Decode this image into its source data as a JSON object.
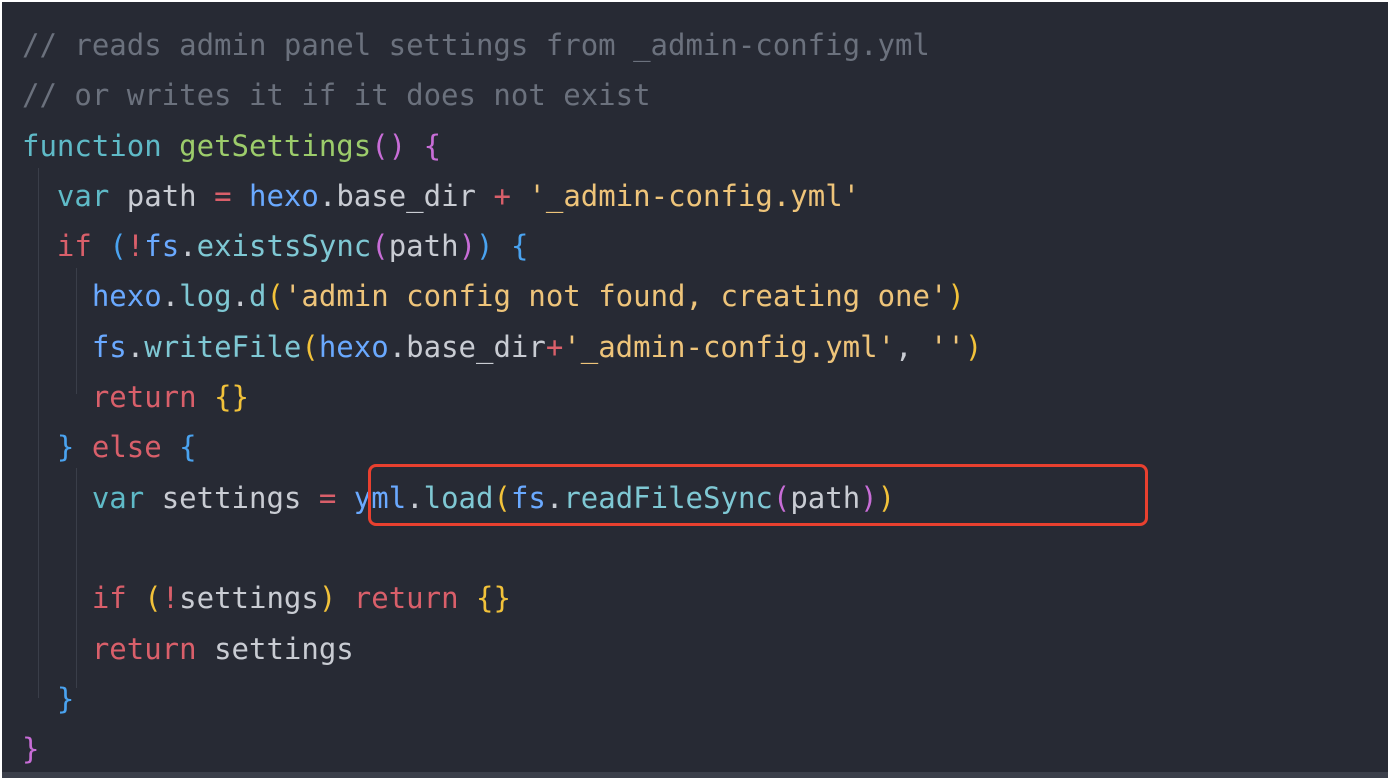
{
  "editor": {
    "lines": [
      [
        {
          "t": "// reads admin panel settings from _admin-config.yml",
          "c": "comment"
        }
      ],
      [
        {
          "t": "// or writes it if it does not exist",
          "c": "comment"
        }
      ],
      [
        {
          "t": "function",
          "c": "storage"
        },
        {
          "t": " ",
          "c": "plain"
        },
        {
          "t": "getSettings",
          "c": "func"
        },
        {
          "t": "()",
          "c": "brace-p"
        },
        {
          "t": " ",
          "c": "plain"
        },
        {
          "t": "{",
          "c": "brace-p"
        }
      ],
      [
        {
          "t": "  ",
          "c": "plain"
        },
        {
          "t": "var",
          "c": "storage"
        },
        {
          "t": " path ",
          "c": "plain"
        },
        {
          "t": "=",
          "c": "op"
        },
        {
          "t": " ",
          "c": "plain"
        },
        {
          "t": "hexo",
          "c": "obj"
        },
        {
          "t": ".base_dir ",
          "c": "plain"
        },
        {
          "t": "+",
          "c": "op"
        },
        {
          "t": " ",
          "c": "plain"
        },
        {
          "t": "'_admin-config.yml'",
          "c": "string"
        }
      ],
      [
        {
          "t": "  ",
          "c": "plain"
        },
        {
          "t": "if",
          "c": "keyword"
        },
        {
          "t": " ",
          "c": "plain"
        },
        {
          "t": "(",
          "c": "brace-b"
        },
        {
          "t": "!",
          "c": "op"
        },
        {
          "t": "fs",
          "c": "obj"
        },
        {
          "t": ".",
          "c": "plain"
        },
        {
          "t": "existsSync",
          "c": "method"
        },
        {
          "t": "(",
          "c": "brace-p"
        },
        {
          "t": "path",
          "c": "plain"
        },
        {
          "t": ")",
          "c": "brace-p"
        },
        {
          "t": ")",
          "c": "brace-b"
        },
        {
          "t": " ",
          "c": "plain"
        },
        {
          "t": "{",
          "c": "brace-b"
        }
      ],
      [
        {
          "t": "    ",
          "c": "plain"
        },
        {
          "t": "hexo",
          "c": "obj"
        },
        {
          "t": ".",
          "c": "plain"
        },
        {
          "t": "log",
          "c": "method"
        },
        {
          "t": ".",
          "c": "plain"
        },
        {
          "t": "d",
          "c": "method"
        },
        {
          "t": "(",
          "c": "brace-y"
        },
        {
          "t": "'admin config not found, creating one'",
          "c": "string"
        },
        {
          "t": ")",
          "c": "brace-y"
        }
      ],
      [
        {
          "t": "    ",
          "c": "plain"
        },
        {
          "t": "fs",
          "c": "obj"
        },
        {
          "t": ".",
          "c": "plain"
        },
        {
          "t": "writeFile",
          "c": "method"
        },
        {
          "t": "(",
          "c": "brace-y"
        },
        {
          "t": "hexo",
          "c": "obj"
        },
        {
          "t": ".base_dir",
          "c": "plain"
        },
        {
          "t": "+",
          "c": "op"
        },
        {
          "t": "'_admin-config.yml'",
          "c": "string"
        },
        {
          "t": ", ",
          "c": "plain"
        },
        {
          "t": "''",
          "c": "string"
        },
        {
          "t": ")",
          "c": "brace-y"
        }
      ],
      [
        {
          "t": "    ",
          "c": "plain"
        },
        {
          "t": "return",
          "c": "keyword"
        },
        {
          "t": " ",
          "c": "plain"
        },
        {
          "t": "{}",
          "c": "brace-y"
        }
      ],
      [
        {
          "t": "  ",
          "c": "plain"
        },
        {
          "t": "}",
          "c": "brace-b"
        },
        {
          "t": " ",
          "c": "plain"
        },
        {
          "t": "else",
          "c": "keyword"
        },
        {
          "t": " ",
          "c": "plain"
        },
        {
          "t": "{",
          "c": "brace-b"
        }
      ],
      [
        {
          "t": "    ",
          "c": "plain"
        },
        {
          "t": "var",
          "c": "storage"
        },
        {
          "t": " settings ",
          "c": "plain"
        },
        {
          "t": "=",
          "c": "op"
        },
        {
          "t": " ",
          "c": "plain"
        },
        {
          "t": "yml",
          "c": "obj"
        },
        {
          "t": ".",
          "c": "plain"
        },
        {
          "t": "load",
          "c": "method"
        },
        {
          "t": "(",
          "c": "brace-y"
        },
        {
          "t": "fs",
          "c": "obj"
        },
        {
          "t": ".",
          "c": "plain"
        },
        {
          "t": "readFileSync",
          "c": "method"
        },
        {
          "t": "(",
          "c": "brace-p"
        },
        {
          "t": "path",
          "c": "plain"
        },
        {
          "t": ")",
          "c": "brace-p"
        },
        {
          "t": ")",
          "c": "brace-y"
        }
      ],
      [],
      [
        {
          "t": "    ",
          "c": "plain"
        },
        {
          "t": "if",
          "c": "keyword"
        },
        {
          "t": " ",
          "c": "plain"
        },
        {
          "t": "(",
          "c": "brace-y"
        },
        {
          "t": "!",
          "c": "op"
        },
        {
          "t": "settings",
          "c": "plain"
        },
        {
          "t": ")",
          "c": "brace-y"
        },
        {
          "t": " ",
          "c": "plain"
        },
        {
          "t": "return",
          "c": "keyword"
        },
        {
          "t": " ",
          "c": "plain"
        },
        {
          "t": "{}",
          "c": "brace-y"
        }
      ],
      [
        {
          "t": "    ",
          "c": "plain"
        },
        {
          "t": "return",
          "c": "keyword"
        },
        {
          "t": " settings",
          "c": "plain"
        }
      ],
      [
        {
          "t": "  ",
          "c": "plain"
        },
        {
          "t": "}",
          "c": "brace-b"
        }
      ],
      [
        {
          "t": "}",
          "c": "brace-p"
        }
      ]
    ],
    "highlighted_line": 9,
    "colors": {
      "background": "#272a34",
      "highlight_border": "#e8402f",
      "comment": "#6b717d",
      "keyword": "#d95f6a",
      "storage": "#5fbac7",
      "function": "#9ccc6b",
      "string": "#eec47a",
      "object": "#6aa9ff"
    }
  }
}
